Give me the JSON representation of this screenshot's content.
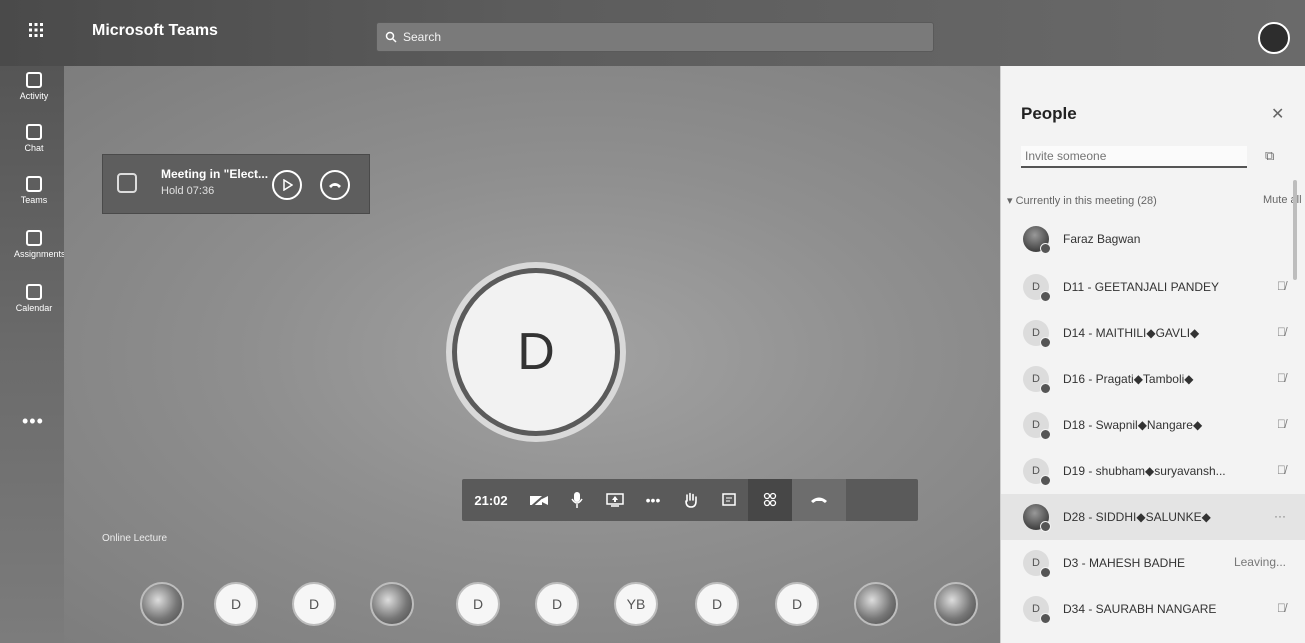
{
  "app": {
    "title": "Microsoft Teams"
  },
  "search": {
    "placeholder": "Search"
  },
  "rail": [
    {
      "label": "Activity",
      "icon": "bell-icon"
    },
    {
      "label": "Chat",
      "icon": "chat-icon"
    },
    {
      "label": "Teams",
      "icon": "teams-icon"
    },
    {
      "label": "Assignments",
      "icon": "assignments-icon"
    },
    {
      "label": "Calendar",
      "icon": "calendar-icon"
    }
  ],
  "held_meeting": {
    "title": "Meeting in \"Elect...",
    "status": "Hold 07:36"
  },
  "stage": {
    "avatar_initial": "D",
    "bottom_text": "Online Lecture"
  },
  "controls": {
    "timer": "21:02"
  },
  "strip": [
    "D",
    "D",
    "D",
    "D",
    "YB",
    "D",
    "D"
  ],
  "people": {
    "title": "People",
    "invite_placeholder": "Invite someone",
    "section_label": "Currently in this meeting (28)",
    "mute_all": "Mute all",
    "participants": [
      {
        "name": "Faraz Bagwan",
        "initial": "",
        "state": ""
      },
      {
        "name": "D11 - GEETANJALI PANDEY",
        "initial": "D",
        "state": "mic-off"
      },
      {
        "name": "D14 - MAITHILI◆GAVLI◆",
        "initial": "D",
        "state": "mic-off"
      },
      {
        "name": "D16 - Pragati◆Tamboli◆",
        "initial": "D",
        "state": "mic-off"
      },
      {
        "name": "D18 - Swapnil◆Nangare◆",
        "initial": "D",
        "state": "mic-off"
      },
      {
        "name": "D19 - shubham◆suryavansh...",
        "initial": "D",
        "state": "mic-off"
      },
      {
        "name": "D28 - SIDDHI◆SALUNKE◆",
        "initial": "",
        "state": "more"
      },
      {
        "name": "D3 - MAHESH BADHE",
        "initial": "D",
        "state": "Leaving..."
      },
      {
        "name": "D34 - SAURABH NANGARE",
        "initial": "D",
        "state": "mic-off"
      }
    ]
  }
}
